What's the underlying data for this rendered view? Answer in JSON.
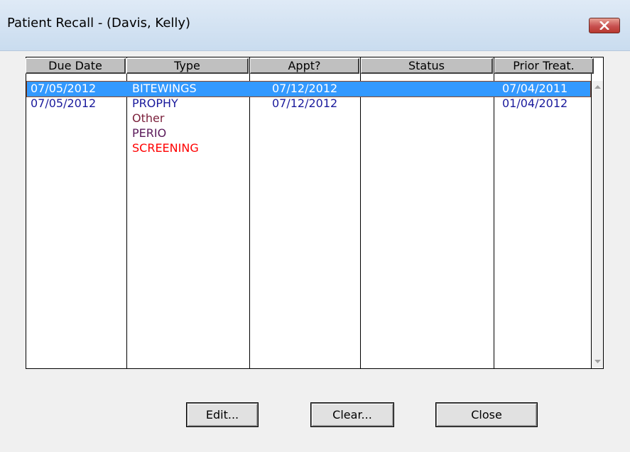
{
  "window": {
    "title": "Patient Recall - (Davis, Kelly)"
  },
  "columns": [
    "Due Date",
    "Type",
    "Appt?",
    "Status",
    "Prior Treat."
  ],
  "rows": [
    {
      "due_date": "07/05/2012",
      "types": [
        "BITEWINGS"
      ],
      "appt": "07/12/2012",
      "status": "",
      "prior": "07/04/2011",
      "selected": true
    },
    {
      "due_date": "07/05/2012",
      "types": [
        "PROPHY",
        "Other",
        "PERIO",
        "SCREENING"
      ],
      "appt": "07/12/2012",
      "status": "",
      "prior": "01/04/2012",
      "selected": false
    }
  ],
  "buttons": {
    "edit": "Edit...",
    "clear": "Clear...",
    "close": "Close"
  },
  "colors": {
    "row_text": "#1a1a9c",
    "selection": "#3399ff",
    "other": "#7a1f3a",
    "perio": "#5a1a5a",
    "screening": "#ff0000"
  }
}
